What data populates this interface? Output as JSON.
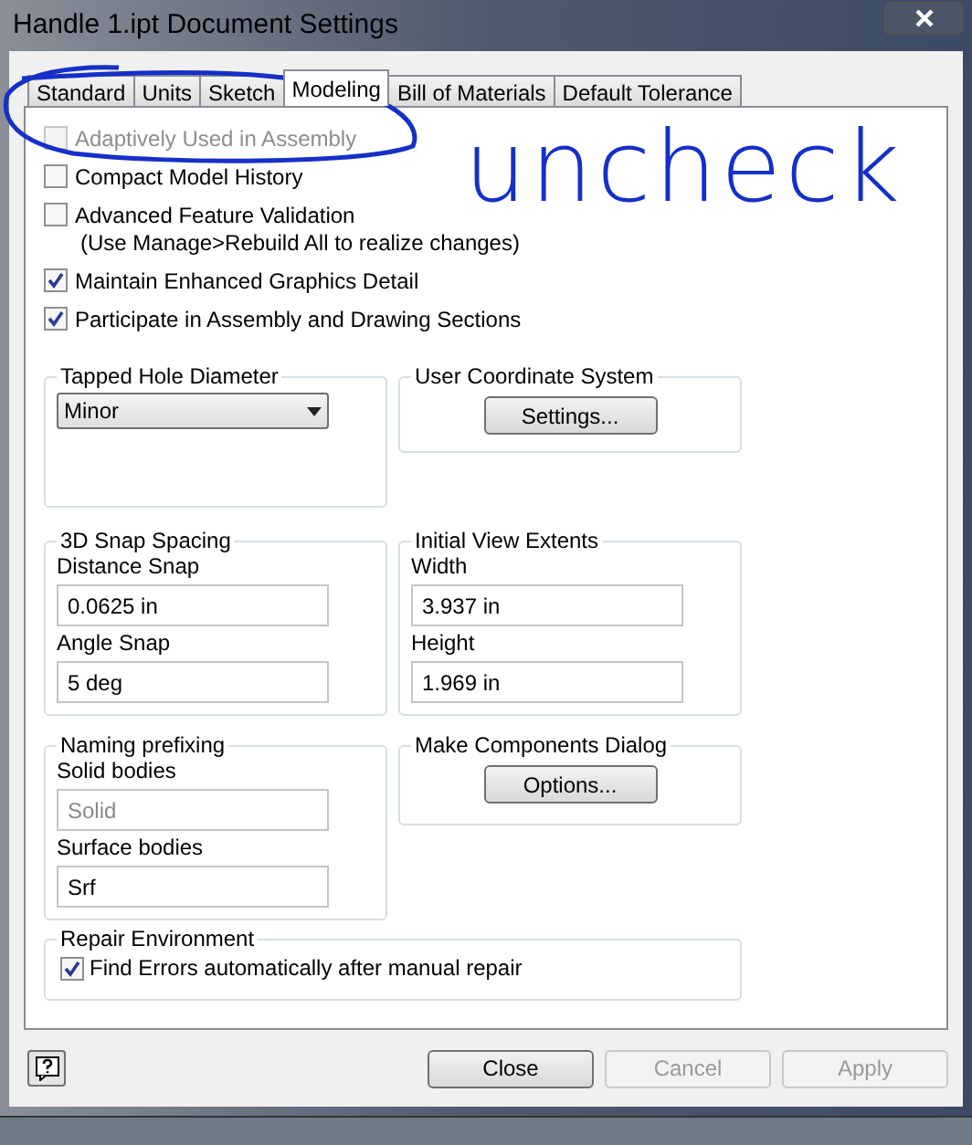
{
  "window": {
    "title": "Handle 1.ipt Document Settings"
  },
  "tabs": [
    {
      "label": "Standard",
      "selected": false
    },
    {
      "label": "Units",
      "selected": false
    },
    {
      "label": "Sketch",
      "selected": false
    },
    {
      "label": "Modeling",
      "selected": true
    },
    {
      "label": "Bill of Materials",
      "selected": false
    },
    {
      "label": "Default Tolerance",
      "selected": false
    }
  ],
  "options": [
    {
      "label": "Adaptively Used in Assembly",
      "checked": false,
      "disabled": true
    },
    {
      "label": "Compact Model History",
      "checked": false,
      "disabled": false
    },
    {
      "label": "Advanced Feature Validation",
      "note": "(Use Manage>Rebuild All to realize changes)",
      "checked": false,
      "disabled": false
    },
    {
      "label": "Maintain Enhanced Graphics Detail",
      "checked": true,
      "disabled": false
    },
    {
      "label": "Participate in Assembly and Drawing Sections",
      "checked": true,
      "disabled": false
    }
  ],
  "tapped_hole_diameter": {
    "title": "Tapped Hole Diameter",
    "value": "Minor"
  },
  "user_coordinate_system": {
    "title": "User Coordinate System",
    "button": "Settings..."
  },
  "snap_spacing": {
    "title": "3D Snap Spacing",
    "fields": [
      {
        "label": "Distance Snap",
        "value": "0.0625 in",
        "disabled": false
      },
      {
        "label": "Angle Snap",
        "value": "5 deg",
        "disabled": false
      }
    ]
  },
  "initial_view_extents": {
    "title": "Initial View Extents",
    "fields": [
      {
        "label": "Width",
        "value": "3.937 in",
        "disabled": false
      },
      {
        "label": "Height",
        "value": "1.969 in",
        "disabled": false
      }
    ]
  },
  "naming_prefixing": {
    "title": "Naming prefixing",
    "fields": [
      {
        "label": "Solid bodies",
        "value": "Solid",
        "disabled": true
      },
      {
        "label": "Surface bodies",
        "value": "Srf",
        "disabled": false
      }
    ]
  },
  "make_components": {
    "title": "Make Components Dialog",
    "button": "Options..."
  },
  "repair_environment": {
    "title": "Repair Environment",
    "option": {
      "label": "Find Errors automatically after manual repair",
      "checked": true
    }
  },
  "footer_buttons": [
    {
      "label": "Close",
      "disabled": false
    },
    {
      "label": "Cancel",
      "disabled": true
    },
    {
      "label": "Apply",
      "disabled": true
    }
  ],
  "annotation": {
    "text": "uncheck"
  }
}
